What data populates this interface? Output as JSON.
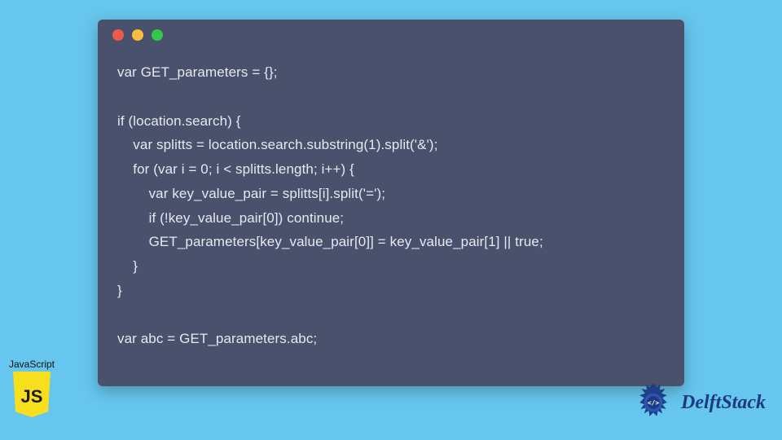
{
  "code": {
    "lines": [
      "var GET_parameters = {};",
      "",
      "if (location.search) {",
      "    var splitts = location.search.substring(1).split('&');",
      "    for (var i = 0; i < splitts.length; i++) {",
      "        var key_value_pair = splitts[i].split('=');",
      "        if (!key_value_pair[0]) continue;",
      "        GET_parameters[key_value_pair[0]] = key_value_pair[1] || true;",
      "    }",
      "}",
      "",
      "var abc = GET_parameters.abc;"
    ]
  },
  "jsBadge": {
    "label": "JavaScript",
    "shieldText": "JS"
  },
  "delft": {
    "brand": "DelftStack"
  },
  "window": {
    "dots": [
      "red",
      "yellow",
      "green"
    ]
  },
  "colors": {
    "pageBg": "#66c6ed",
    "windowBg": "#4a516d",
    "codeText": "#e7e9f0",
    "jsShield": "#f7df1e",
    "delftBlue": "#1c3a82"
  }
}
